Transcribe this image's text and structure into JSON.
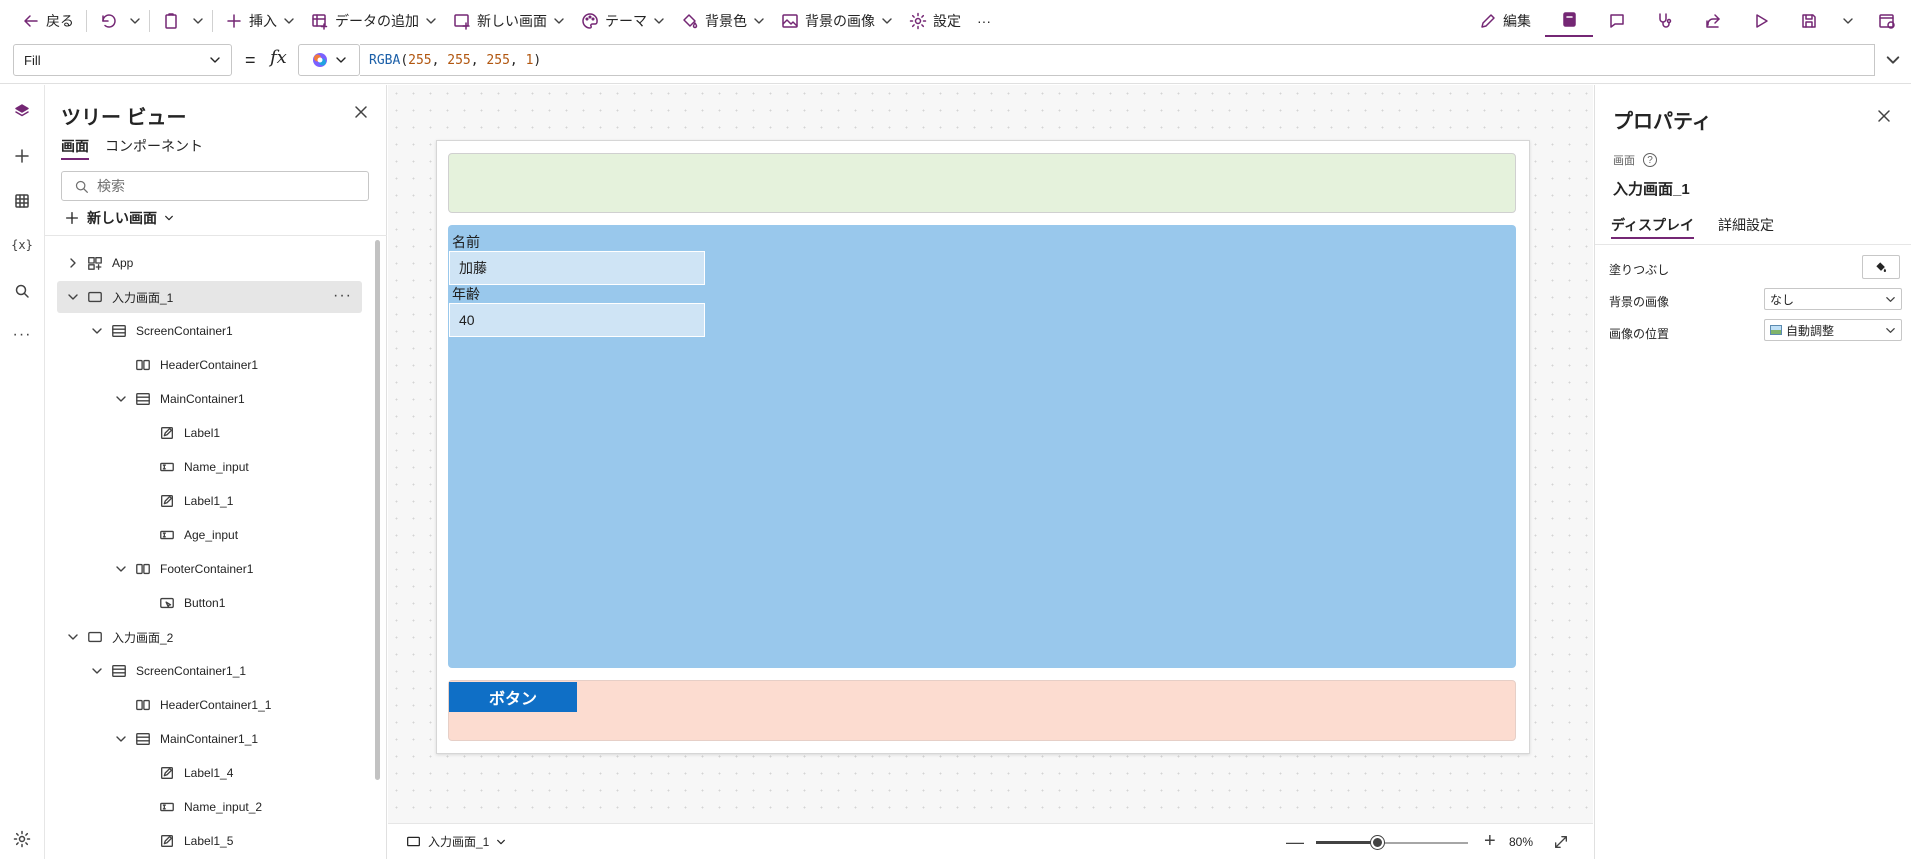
{
  "toolbar": {
    "back": "戻る",
    "insert": "挿入",
    "add_data": "データの追加",
    "new_screen": "新しい画面",
    "theme": "テーマ",
    "background_color": "背景色",
    "background_image": "背景の画像",
    "settings": "設定",
    "more": "···",
    "edit": "編集"
  },
  "formula": {
    "property": "Fill",
    "equals": "=",
    "fx": "fx",
    "fn": "RGBA",
    "open": "(",
    "args": [
      "255",
      "255",
      "255",
      "1"
    ],
    "close": ")"
  },
  "tree": {
    "title": "ツリー ビュー",
    "tabs": [
      "画面",
      "コンポーネント"
    ],
    "search_placeholder": "検索",
    "new_screen": "新しい画面",
    "items": [
      {
        "label": "App",
        "icon": "app-icon",
        "depth": 0,
        "expander": "right",
        "selected": false
      },
      {
        "label": "入力画面_1",
        "icon": "screen-icon",
        "depth": 0,
        "expander": "down",
        "selected": true
      },
      {
        "label": "ScreenContainer1",
        "icon": "vertical-container-icon",
        "depth": 1,
        "expander": "down",
        "selected": false
      },
      {
        "label": "HeaderContainer1",
        "icon": "horizontal-container-icon",
        "depth": 2,
        "expander": "none",
        "selected": false
      },
      {
        "label": "MainContainer1",
        "icon": "vertical-container-icon",
        "depth": 2,
        "expander": "down",
        "selected": false
      },
      {
        "label": "Label1",
        "icon": "label-icon",
        "depth": 3,
        "expander": "none",
        "selected": false
      },
      {
        "label": "Name_input",
        "icon": "text-input-icon",
        "depth": 3,
        "expander": "none",
        "selected": false
      },
      {
        "label": "Label1_1",
        "icon": "label-icon",
        "depth": 3,
        "expander": "none",
        "selected": false
      },
      {
        "label": "Age_input",
        "icon": "text-input-icon",
        "depth": 3,
        "expander": "none",
        "selected": false
      },
      {
        "label": "FooterContainer1",
        "icon": "horizontal-container-icon",
        "depth": 2,
        "expander": "down",
        "selected": false
      },
      {
        "label": "Button1",
        "icon": "button-icon",
        "depth": 3,
        "expander": "none",
        "selected": false
      },
      {
        "label": "入力画面_2",
        "icon": "screen-icon",
        "depth": 0,
        "expander": "down",
        "selected": false
      },
      {
        "label": "ScreenContainer1_1",
        "icon": "vertical-container-icon",
        "depth": 1,
        "expander": "down",
        "selected": false
      },
      {
        "label": "HeaderContainer1_1",
        "icon": "horizontal-container-icon",
        "depth": 2,
        "expander": "none",
        "selected": false
      },
      {
        "label": "MainContainer1_1",
        "icon": "vertical-container-icon",
        "depth": 2,
        "expander": "down",
        "selected": false
      },
      {
        "label": "Label1_4",
        "icon": "label-icon",
        "depth": 3,
        "expander": "none",
        "selected": false
      },
      {
        "label": "Name_input_2",
        "icon": "text-input-icon",
        "depth": 3,
        "expander": "none",
        "selected": false
      },
      {
        "label": "Label1_5",
        "icon": "label-icon",
        "depth": 3,
        "expander": "none",
        "selected": false
      }
    ]
  },
  "canvas": {
    "name_label": "名前",
    "name_value": "加藤",
    "age_label": "年齢",
    "age_value": "40",
    "button_text": "ボタン",
    "colors": {
      "header": "#e5f2dc",
      "main": "#99c8ec",
      "footer": "#fcdcd0",
      "button": "#0f6fc6"
    }
  },
  "status": {
    "screen": "入力画面_1",
    "zoom": "80%",
    "zoom_level": 0.4
  },
  "properties": {
    "title": "プロパティ",
    "kind": "画面",
    "name": "入力画面_1",
    "tabs": [
      "ディスプレイ",
      "詳細設定"
    ],
    "fill_label": "塗りつぶし",
    "bg_image_label": "背景の画像",
    "bg_image_value": "なし",
    "image_position_label": "画像の位置",
    "image_position_value": "自動調整"
  },
  "accent": "#742774"
}
